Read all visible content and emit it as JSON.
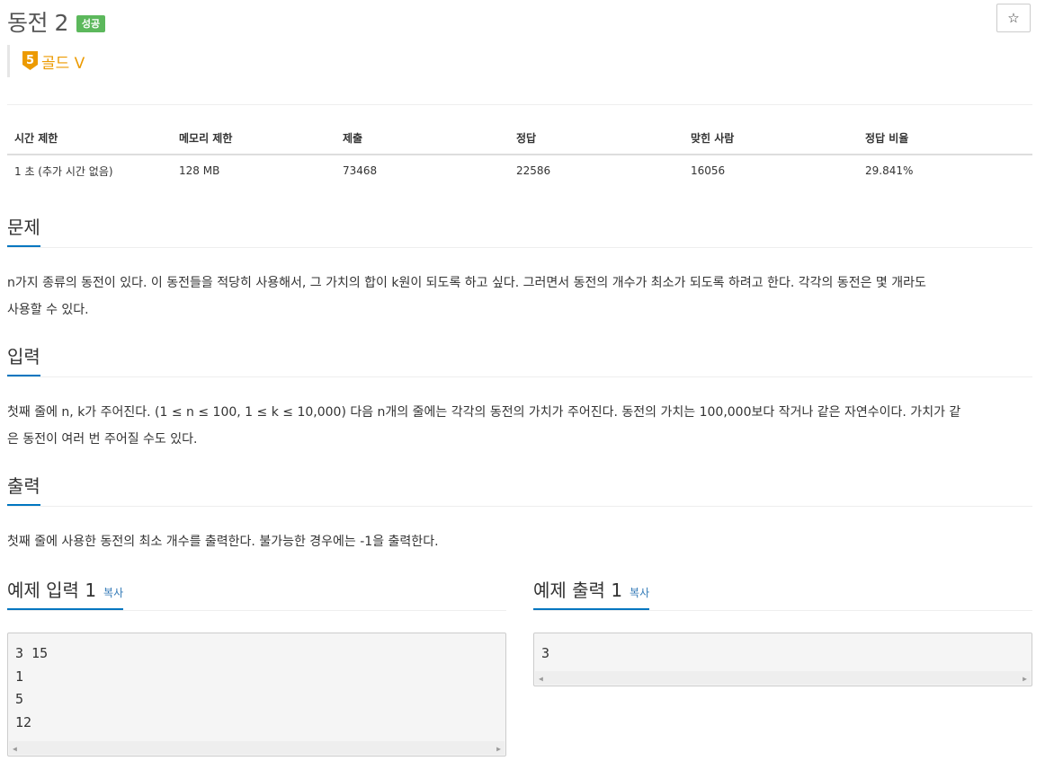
{
  "problem": {
    "title": "동전 2",
    "status_badge": "성공",
    "tier_number": "5",
    "tier_label": "골드 V"
  },
  "actions": {
    "star_glyph": "☆"
  },
  "info_table": {
    "headers": [
      "시간 제한",
      "메모리 제한",
      "제출",
      "정답",
      "맞힌 사람",
      "정답 비율"
    ],
    "values": [
      "1 초 (추가 시간 없음)",
      "128 MB",
      "73468",
      "22586",
      "16056",
      "29.841%"
    ]
  },
  "sections": {
    "problem": {
      "heading": "문제",
      "line1": "n가지 종류의 동전이 있다. 이 동전들을 적당히 사용해서, 그 가치의 합이 k원이 되도록 하고 싶다. 그러면서 동전의 개수가 최소가 되도록 하려고 한다. 각각의 동전은 몇 개라도",
      "line2": "사용할 수 있다."
    },
    "input": {
      "heading": "입력",
      "line1": "첫째 줄에 n, k가 주어진다. (1 ≤ n ≤ 100, 1 ≤ k ≤ 10,000) 다음 n개의 줄에는 각각의 동전의 가치가 주어진다. 동전의 가치는 100,000보다 작거나 같은 자연수이다. 가치가 같",
      "line2": "은 동전이 여러 번 주어질 수도 있다."
    },
    "output": {
      "heading": "출력",
      "line1": "첫째 줄에 사용한 동전의 최소 개수를 출력한다. 불가능한 경우에는 -1을 출력한다."
    }
  },
  "samples": {
    "input": {
      "heading": "예제 입력 1",
      "copy": "복사",
      "lines": [
        "3 15",
        "1",
        "5",
        "12"
      ]
    },
    "output": {
      "heading": "예제 출력 1",
      "copy": "복사",
      "lines": [
        "3"
      ]
    }
  },
  "colors": {
    "accent": "#0076c0",
    "success": "#5cb85c",
    "gold": "#ec9a00",
    "link": "#337ab7"
  },
  "icons": {
    "tier": "gold-5-tier-icon",
    "star": "star-icon",
    "scroll_left": "scroll-left-arrow-icon",
    "scroll_right": "scroll-right-arrow-icon"
  }
}
